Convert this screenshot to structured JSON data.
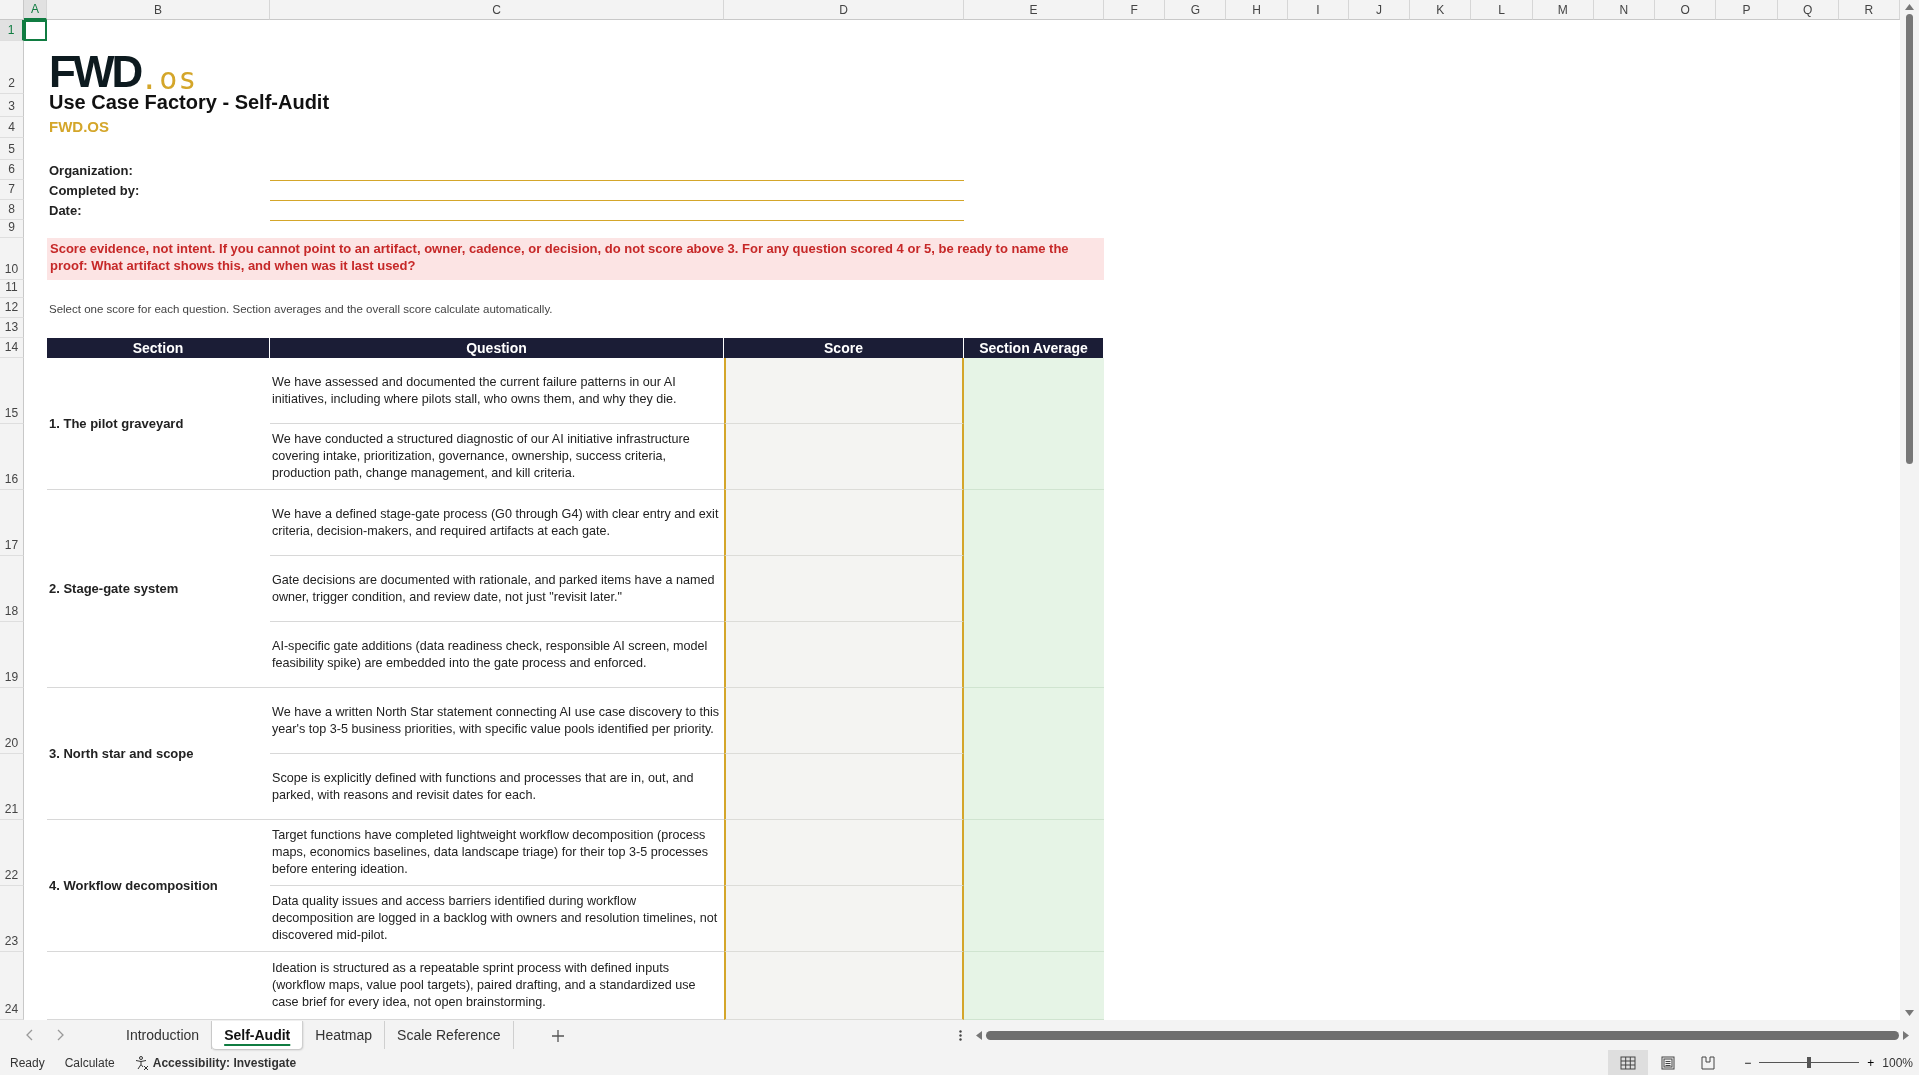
{
  "sheet": {
    "columns": [
      {
        "label": "A",
        "selected": true
      },
      {
        "label": "B",
        "selected": false
      },
      {
        "label": "C",
        "selected": false
      },
      {
        "label": "D",
        "selected": false
      },
      {
        "label": "E",
        "selected": false
      },
      {
        "label": "F",
        "selected": false
      },
      {
        "label": "G",
        "selected": false
      },
      {
        "label": "H",
        "selected": false
      },
      {
        "label": "I",
        "selected": false
      },
      {
        "label": "J",
        "selected": false
      },
      {
        "label": "K",
        "selected": false
      },
      {
        "label": "L",
        "selected": false
      },
      {
        "label": "M",
        "selected": false
      },
      {
        "label": "N",
        "selected": false
      },
      {
        "label": "O",
        "selected": false
      },
      {
        "label": "P",
        "selected": false
      },
      {
        "label": "Q",
        "selected": false
      },
      {
        "label": "R",
        "selected": false
      }
    ],
    "rows": [
      {
        "label": "1",
        "selected": true
      },
      {
        "label": "2",
        "selected": false
      },
      {
        "label": "3",
        "selected": false
      },
      {
        "label": "4",
        "selected": false
      },
      {
        "label": "5",
        "selected": false
      },
      {
        "label": "6",
        "selected": false
      },
      {
        "label": "7",
        "selected": false
      },
      {
        "label": "8",
        "selected": false
      },
      {
        "label": "9",
        "selected": false
      },
      {
        "label": "10",
        "selected": false
      },
      {
        "label": "11",
        "selected": false
      },
      {
        "label": "12",
        "selected": false
      },
      {
        "label": "13",
        "selected": false
      },
      {
        "label": "14",
        "selected": false
      },
      {
        "label": "15",
        "selected": false
      },
      {
        "label": "16",
        "selected": false
      },
      {
        "label": "17",
        "selected": false
      },
      {
        "label": "18",
        "selected": false
      },
      {
        "label": "19",
        "selected": false
      },
      {
        "label": "20",
        "selected": false
      },
      {
        "label": "21",
        "selected": false
      },
      {
        "label": "22",
        "selected": false
      },
      {
        "label": "23",
        "selected": false
      },
      {
        "label": "24",
        "selected": false
      }
    ]
  },
  "logo": {
    "main": "FWD",
    "suffix": ".os"
  },
  "title": "Use Case Factory - Self-Audit",
  "brand": "FWD.OS",
  "fields": [
    {
      "label": "Organization:"
    },
    {
      "label": "Completed by:"
    },
    {
      "label": "Date:"
    }
  ],
  "warning": "Score evidence, not intent. If you cannot point to an artifact, owner, cadence, or decision, do not score above 3. For any question scored 4 or 5, be ready to name the proof: What artifact shows this, and when was it last used?",
  "instruction": "Select one score for each question. Section averages and the overall score calculate automatically.",
  "table": {
    "columns": [
      "Section",
      "Question",
      "Score",
      "Section Average"
    ],
    "sections": [
      {
        "label": "1. The pilot graveyard",
        "questions": [
          "We have assessed and documented the current failure patterns in our AI initiatives, including where pilots stall, who owns them, and why they die.",
          "We have conducted a structured diagnostic of our AI initiative infrastructure covering intake, prioritization, governance, ownership, success criteria, production path, change management, and kill criteria."
        ]
      },
      {
        "label": "2. Stage-gate system",
        "questions": [
          "We have a defined stage-gate process (G0 through G4) with clear entry and exit criteria, decision-makers, and required artifacts at each gate.",
          "Gate decisions are documented with rationale, and parked items have a named owner, trigger condition, and review date, not just \"revisit later.\"",
          "AI-specific gate additions (data readiness check, responsible AI screen, model feasibility spike) are embedded into the gate process and enforced."
        ]
      },
      {
        "label": "3. North star and scope",
        "questions": [
          "We have a written North Star statement connecting AI use case discovery to this year's top 3-5 business priorities, with specific value pools identified per priority.",
          "Scope is explicitly defined with functions and processes that are in, out, and parked, with reasons and revisit dates for each."
        ]
      },
      {
        "label": "4. Workflow decomposition",
        "questions": [
          "Target functions have completed lightweight workflow decomposition (process maps, economics baselines, data landscape triage) for their top 3-5 processes before entering ideation.",
          "Data quality issues and access barriers identified during workflow decomposition are logged in a backlog with owners and resolution timelines, not discovered mid-pilot."
        ]
      },
      {
        "questions": [
          "Ideation is structured as a repeatable sprint process with defined inputs (workflow maps, value pool targets), paired drafting, and a standardized use case brief for every idea, not open brainstorming."
        ]
      }
    ]
  },
  "sheet_tabs": [
    {
      "label": "Introduction",
      "selected": false
    },
    {
      "label": "Self-Audit",
      "selected": true
    },
    {
      "label": "Heatmap",
      "selected": false
    },
    {
      "label": "Scale Reference",
      "selected": false
    }
  ],
  "status_bar": {
    "items": [
      "Ready",
      "Calculate"
    ],
    "accessibility": "Accessibility: Investigate",
    "views": [
      {
        "kind": "normal",
        "selected": true
      },
      {
        "kind": "page-layout",
        "selected": false
      },
      {
        "kind": "page-break",
        "selected": false
      }
    ],
    "zoom": {
      "out": "−",
      "in": "+",
      "level": 0.5,
      "label": "100%"
    }
  }
}
